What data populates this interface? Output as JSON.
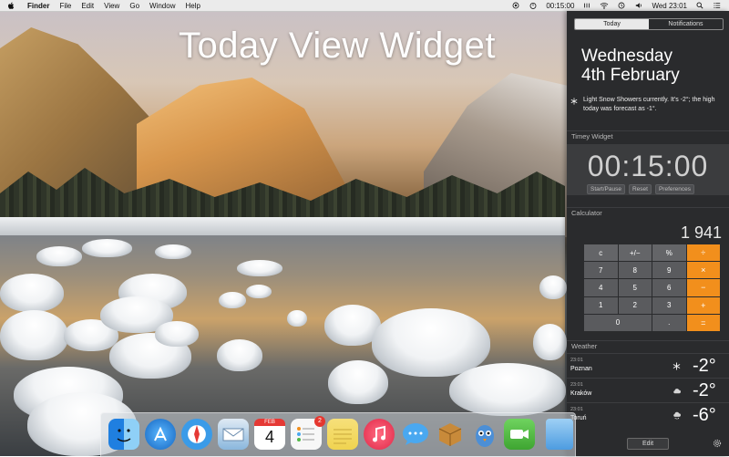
{
  "menubar": {
    "app_name": "Finder",
    "items": [
      "File",
      "Edit",
      "View",
      "Go",
      "Window",
      "Help"
    ],
    "timer": "00:15:00",
    "clock": "Wed 23:01",
    "icons": [
      "apple-icon",
      "record-icon",
      "timer-icon",
      "wifi-icon",
      "time-machine-icon",
      "volume-icon",
      "search-icon",
      "list-icon"
    ]
  },
  "desktop": {
    "title": "Today View Widget"
  },
  "notification_center": {
    "tabs": {
      "today": "Today",
      "notifications": "Notifications"
    },
    "date": {
      "day": "Wednesday",
      "full": "4th February"
    },
    "forecast": "Light Snow Showers currently. It's -2°; the high today was forecast as -1°.",
    "timey": {
      "header": "Timey Widget",
      "time": "00:15:00",
      "buttons": [
        "Start/Pause",
        "Reset",
        "Preferences"
      ]
    },
    "calculator": {
      "header": "Calculator",
      "display": "1 941",
      "keys": [
        "c",
        "+/−",
        "%",
        "÷",
        "7",
        "8",
        "9",
        "×",
        "4",
        "5",
        "6",
        "−",
        "1",
        "2",
        "3",
        "+",
        "0",
        ".",
        "="
      ]
    },
    "weather": {
      "header": "Weather",
      "cities": [
        {
          "time": "23:01",
          "city": "Poznan",
          "temp": "-2°",
          "icon": "snow-icon"
        },
        {
          "time": "23:01",
          "city": "Kraków",
          "temp": "-2°",
          "icon": "cloud-icon"
        },
        {
          "time": "23:01",
          "city": "Toruń",
          "temp": "-6°",
          "icon": "snow-cloud-icon"
        }
      ]
    },
    "edit_label": "Edit"
  },
  "dock": {
    "apps": [
      {
        "name": "finder",
        "color": "#2b8be6"
      },
      {
        "name": "app-store",
        "color": "#1e88e5"
      },
      {
        "name": "safari",
        "color": "#3a9be8"
      },
      {
        "name": "mail",
        "color": "#8ab7dd"
      },
      {
        "name": "calendar",
        "color": "#ffffff",
        "month": "FEB",
        "day": "4"
      },
      {
        "name": "reminders",
        "color": "#f7f7f7",
        "badge": "2"
      },
      {
        "name": "notes",
        "color": "#f6e07a"
      },
      {
        "name": "itunes",
        "color": "#f2445c"
      },
      {
        "name": "messages",
        "color": "#4aa8f0"
      },
      {
        "name": "package",
        "color": "#c88a3a"
      },
      {
        "name": "tweetbot",
        "color": "#4c8fd6"
      },
      {
        "name": "facetime",
        "color": "#53b848"
      },
      {
        "name": "downloads-folder",
        "color": "#6ab0ea"
      }
    ]
  },
  "colors": {
    "accent_orange": "#f28f1c",
    "panel_bg": "#2a2b2d"
  }
}
